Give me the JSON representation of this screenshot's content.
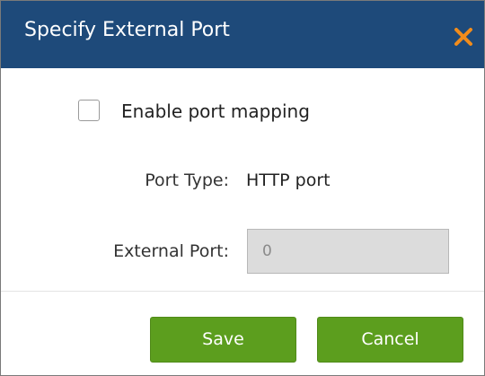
{
  "dialog": {
    "title": "Specify External Port",
    "close_icon": "close-x-icon"
  },
  "form": {
    "enable_port_mapping": {
      "label": "Enable port mapping",
      "checked": false
    },
    "port_type": {
      "label": "Port Type:",
      "value": "HTTP port"
    },
    "external_port": {
      "label": "External Port:",
      "value": "0",
      "disabled": true
    }
  },
  "buttons": {
    "save_label": "Save",
    "cancel_label": "Cancel"
  },
  "colors": {
    "titlebar": "#1e4a7a",
    "close_icon": "#f28c1b",
    "button": "#5c9e1e"
  }
}
